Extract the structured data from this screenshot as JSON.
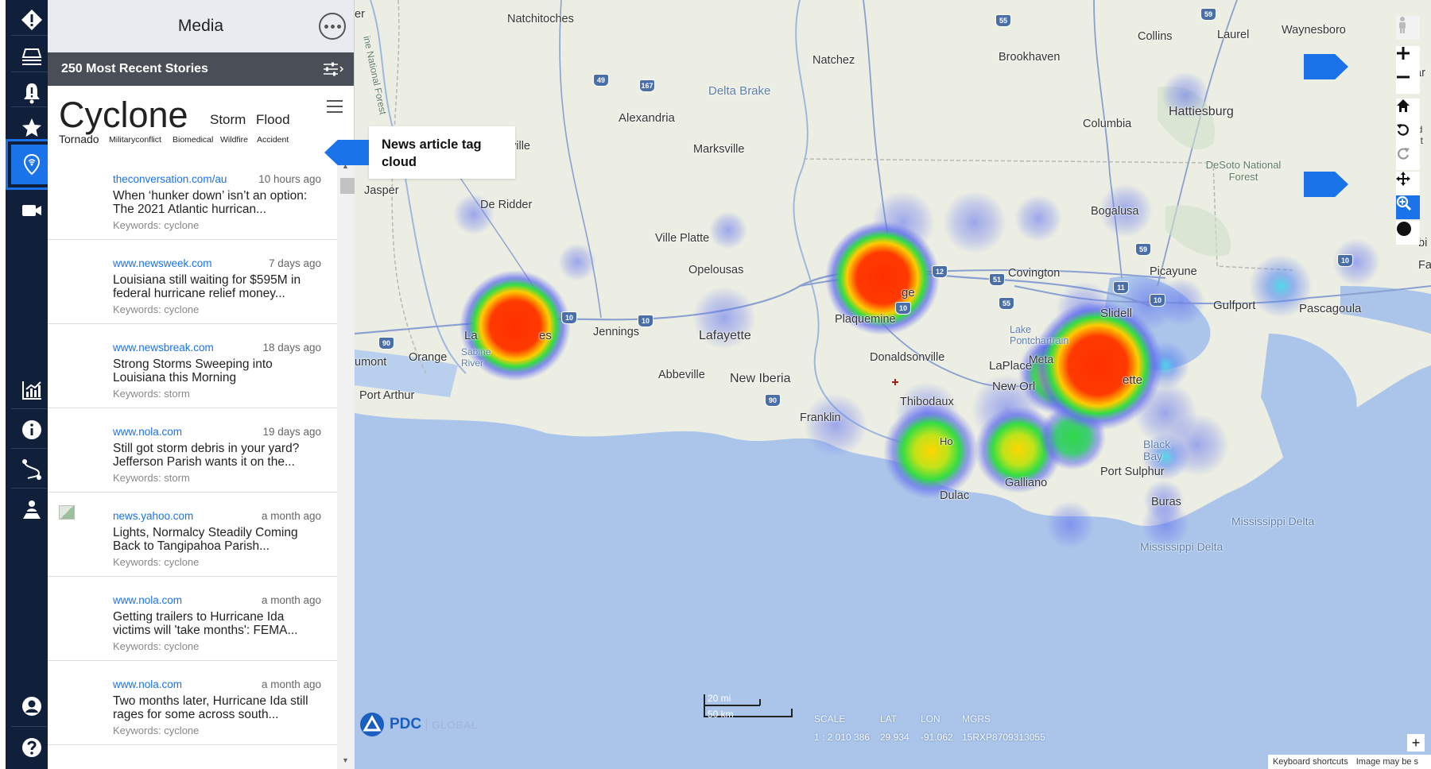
{
  "panel": {
    "title": "Media",
    "stories_label": "250 Most Recent Stories"
  },
  "tagcloud": {
    "tags": [
      "Cyclone",
      "Storm",
      "Flood",
      "Tornado",
      "Militaryconflict",
      "Biomedical",
      "Wildfire",
      "Accident"
    ]
  },
  "callout": {
    "text": "News article tag cloud"
  },
  "stories": [
    {
      "source": "theconversation.com/au",
      "time": "10 hours ago",
      "headline": "When ‘hunker down’ isn’t an option: The 2021 Atlantic hurrican...",
      "keywords": "Keywords: cyclone"
    },
    {
      "source": "www.newsweek.com",
      "time": "7 days ago",
      "headline": "Louisiana still waiting for $595M in federal hurricane relief money...",
      "keywords": "Keywords: cyclone"
    },
    {
      "source": "www.newsbreak.com",
      "time": "18 days ago",
      "headline": "Strong Storms Sweeping into Louisiana this Morning",
      "keywords": "Keywords: storm"
    },
    {
      "source": "www.nola.com",
      "time": "19 days ago",
      "headline": "Still got storm debris in your yard? Jefferson Parish wants it on the...",
      "keywords": "Keywords: storm"
    },
    {
      "source": "news.yahoo.com",
      "time": "a month ago",
      "headline": "Lights, Normalcy Steadily Coming Back to Tangipahoa Parish...",
      "keywords": "Keywords: cyclone"
    },
    {
      "source": "www.nola.com",
      "time": "a month ago",
      "headline": "Getting trailers to Hurricane Ida victims will 'take months': FEMA...",
      "keywords": "Keywords: cyclone"
    },
    {
      "source": "www.nola.com",
      "time": "a month ago",
      "headline": "Two months later, Hurricane Ida still rages for some across south...",
      "keywords": "Keywords: cyclone"
    }
  ],
  "map": {
    "places": {
      "natchitoches": "Natchitoches",
      "alexandria": "Alexandria",
      "natchez": "Natchez",
      "brookhaven": "Brookhaven",
      "collins": "Collins",
      "laurel": "Laurel",
      "waynesboro": "Waynesboro",
      "hattiesburg": "Hattiesburg",
      "columbia": "Columbia",
      "marksville": "Marksville",
      "jasper": "Jasper",
      "deridder": "De Ridder",
      "villeplatte": "Ville Platte",
      "opelousas": "Opelousas",
      "bogalusa": "Bogalusa",
      "picayune": "Picayune",
      "covington": "Covington",
      "slidell": "Slidell",
      "gulfport": "Gulfport",
      "pascagoula": "Pascagoula",
      "jennings": "Jennings",
      "lafayette": "Lafayette",
      "plaquemine": "Plaquemine",
      "donaldsonville": "Donaldsonville",
      "orange": "Orange",
      "beaumont": "umont",
      "portarthur": "Port Arthur",
      "abbeville": "Abbeville",
      "newiberia": "New Iberia",
      "thibodaux": "Thibodaux",
      "franklin": "Franklin",
      "laplace": "LaPlace",
      "neworleans": "New Orl",
      "metairie": "Meta",
      "lakepontchartrain": "Lake Pontchartrain",
      "ette": "ette",
      "galliano": "Galliano",
      "dulac": "Dulac",
      "portsulphur": "Port Sulphur",
      "buras": "Buras",
      "blackbay": "Black Bay",
      "sabineriver": "Sabine River",
      "deltabrake": "Delta Brake",
      "mississippidelta1": "Mississippi Delta",
      "mississippidelta2": "Mississippi Delta",
      "desoto": "DeSoto National Forest",
      "kisatchie": "ine National Forest",
      "ville": "ville",
      "er": "er",
      "ar": "ar",
      "lc": "La",
      "es": "es",
      "ge": "ge",
      "fa": "Fa",
      "bi": "bi",
      "idnt": "id nt",
      "ho": "Ho"
    },
    "shields": [
      "55",
      "59",
      "49",
      "167",
      "10",
      "10",
      "90",
      "90",
      "12",
      "51",
      "55",
      "10",
      "59",
      "11",
      "10",
      "10"
    ],
    "heat_colors": {
      "high": "#ff3000",
      "mid": "#ffd400",
      "low": "#33dd33",
      "base": "#6a6ff0"
    }
  },
  "readout": {
    "scale_mi": "20 mi",
    "scale_km": "50 km",
    "scale_label": "SCALE",
    "scale_value": "1 : 2 010 386",
    "lat_label": "LAT",
    "lat_value": "29.934",
    "lon_label": "LON",
    "lon_value": "-91.062",
    "mgrs_label": "MGRS",
    "mgrs_value": "15RXP8709313055"
  },
  "logo": {
    "brand": "PDC",
    "sub": "GLOBAL"
  },
  "attribution": {
    "shortcuts": "Keyboard shortcuts",
    "image": "Image may be s"
  }
}
